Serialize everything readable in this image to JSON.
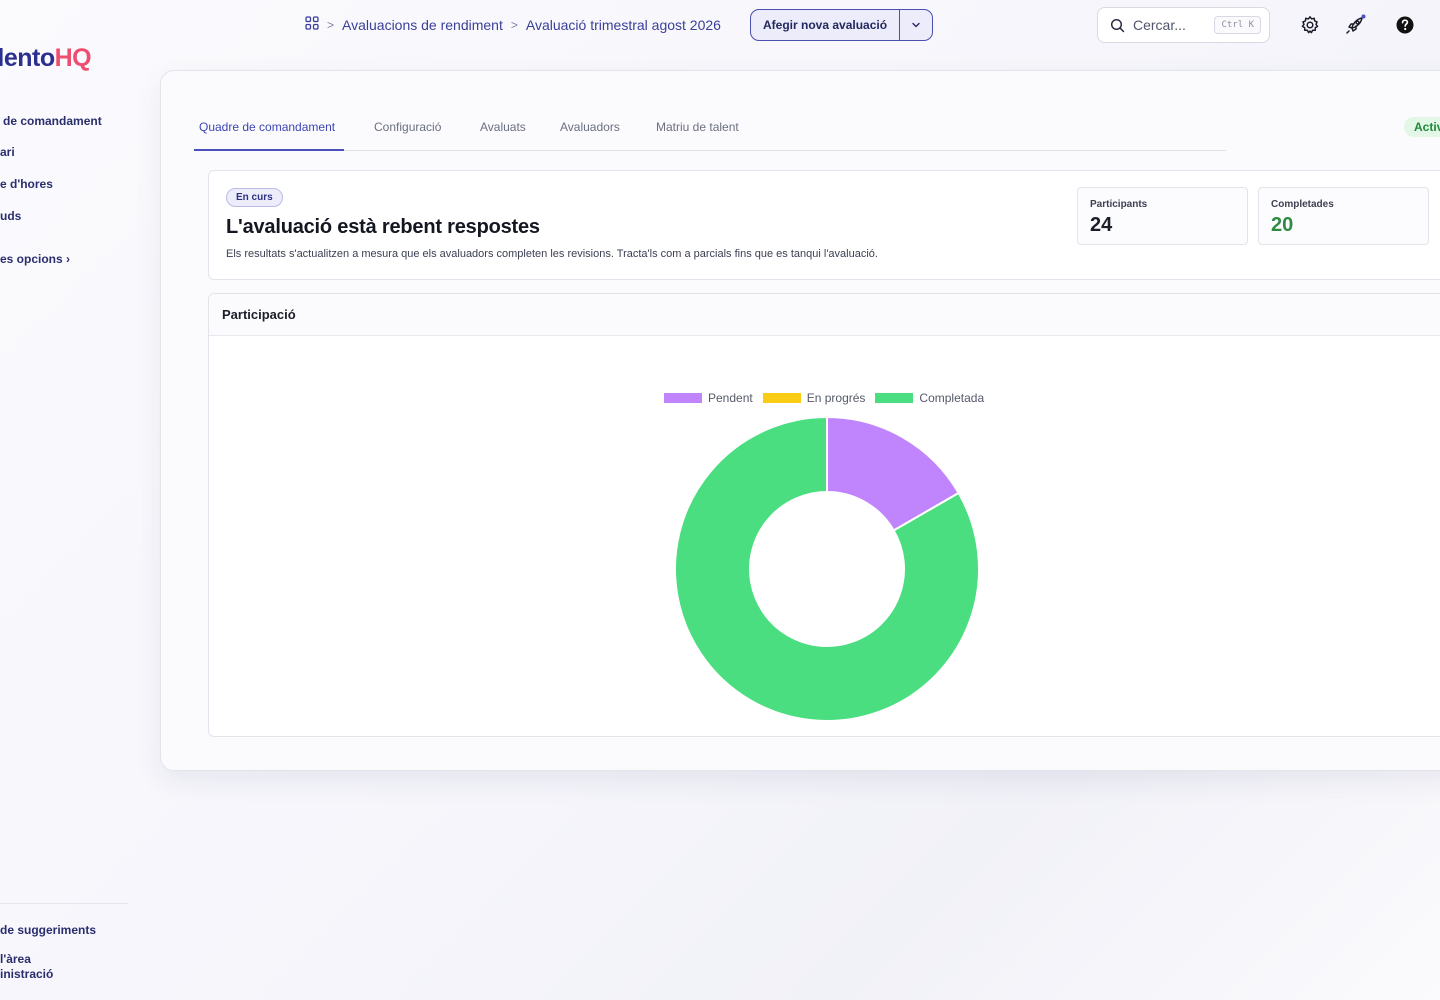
{
  "app": {
    "logo_part1": "alento",
    "logo_part2": "HQ"
  },
  "sidebar": {
    "items": [
      {
        "label": "de comandament"
      },
      {
        "label": "ari"
      },
      {
        "label": "e d'hores"
      },
      {
        "label": "uds"
      },
      {
        "label": "es opcions ›"
      }
    ],
    "bottom_items": [
      {
        "label": "de suggeriments"
      },
      {
        "label": "l'àrea"
      },
      {
        "label": "inistració"
      }
    ]
  },
  "breadcrumb": {
    "items": [
      "Avaluacions de rendiment",
      "Avaluació trimestral agost 2026"
    ]
  },
  "header": {
    "add_button_label": "Afegir nova avaluació"
  },
  "search": {
    "placeholder": "Cercar...",
    "shortcut": "Ctrl K"
  },
  "tabs": [
    {
      "label": "Quadre de comandament",
      "active": true
    },
    {
      "label": "Configuració"
    },
    {
      "label": "Avaluats"
    },
    {
      "label": "Avaluadors"
    },
    {
      "label": "Matriu de talent"
    }
  ],
  "status_pill": "Activ",
  "status": {
    "badge": "En curs",
    "title": "L'avaluació està rebent respostes",
    "description": "Els resultats s'actualitzen a mesura que els avaluadors completen les revisions. Tracta'ls com a parcials fins que es tanqui l'avaluació."
  },
  "stats": [
    {
      "label": "Participants",
      "value": "24"
    },
    {
      "label": "Completades",
      "value": "20"
    }
  ],
  "participation": {
    "title": "Participació"
  },
  "colors": {
    "pendent": "#c084fc",
    "en_progres": "#facc15",
    "completada": "#4ade80",
    "accent": "#4a50c0"
  },
  "chart_data": {
    "type": "pie",
    "donut": true,
    "categories": [
      "Pendent",
      "En progrés",
      "Completada"
    ],
    "values": [
      4,
      0,
      20
    ],
    "legend": "top"
  }
}
